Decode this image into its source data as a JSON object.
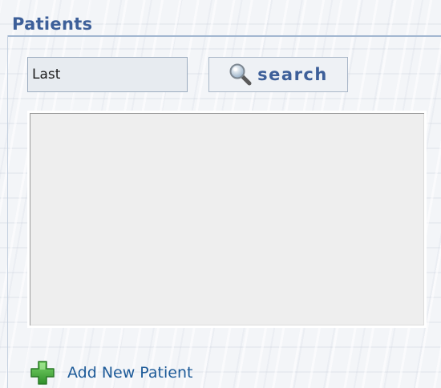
{
  "panel": {
    "title": "Patients"
  },
  "search": {
    "value": "Last",
    "button_label": "search",
    "button_icon": "magnifier-icon"
  },
  "results": {
    "items": []
  },
  "actions": {
    "add_label": "Add New Patient",
    "add_icon": "green-plus-icon"
  },
  "colors": {
    "accent": "#3d5f99",
    "link": "#1e5b99",
    "add_icon": "#3aa335",
    "list_bg": "#eeeeee"
  }
}
